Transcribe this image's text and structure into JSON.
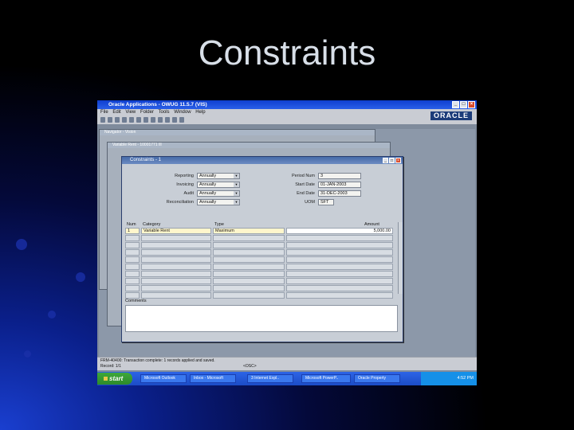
{
  "slide": {
    "title": "Constraints"
  },
  "app": {
    "title": "Oracle Applications - OWUG 11.5.7 (VIS)",
    "logo": "ORACLE",
    "menu": [
      "File",
      "Edit",
      "View",
      "Folder",
      "Tools",
      "Window",
      "Help"
    ]
  },
  "background_windows": [
    {
      "title": "Navigator - Vision"
    },
    {
      "title": "Variable Rent - 10001771 Ill"
    }
  ],
  "constraints_window": {
    "title": "Constraints - 1",
    "left_fields": [
      {
        "label": "Reporting",
        "value": "Annually"
      },
      {
        "label": "Invoicing",
        "value": "Annually"
      },
      {
        "label": "Audit",
        "value": "Annually"
      },
      {
        "label": "Reconciliation",
        "value": "Annually"
      }
    ],
    "right_fields": [
      {
        "label": "Period Num",
        "value": "3"
      },
      {
        "label": "Start Date",
        "value": "01-JAN-2003"
      },
      {
        "label": "End Date",
        "value": "31-DEC-2003"
      },
      {
        "label": "UOM",
        "value": "SFT"
      }
    ],
    "grid": {
      "headers": {
        "num": "Num",
        "category": "Category",
        "type": "Type",
        "amount": "Amount"
      },
      "rows": [
        {
          "num": "1",
          "category": "Variable Rent",
          "type": "Maximum",
          "amount": "5,000.00"
        },
        {
          "num": "",
          "category": "",
          "type": "",
          "amount": ""
        },
        {
          "num": "",
          "category": "",
          "type": "",
          "amount": ""
        },
        {
          "num": "",
          "category": "",
          "type": "",
          "amount": ""
        },
        {
          "num": "",
          "category": "",
          "type": "",
          "amount": ""
        },
        {
          "num": "",
          "category": "",
          "type": "",
          "amount": ""
        },
        {
          "num": "",
          "category": "",
          "type": "",
          "amount": ""
        },
        {
          "num": "",
          "category": "",
          "type": "",
          "amount": ""
        },
        {
          "num": "",
          "category": "",
          "type": "",
          "amount": ""
        },
        {
          "num": "",
          "category": "",
          "type": "",
          "amount": ""
        }
      ]
    },
    "comments_label": "Comments"
  },
  "status": {
    "message": "FRM-40400: Transaction complete: 1 records applied and saved.",
    "record": "Record: 1/1",
    "osc": "<OSC>"
  },
  "taskbar": {
    "start": "start",
    "tasks": [
      "Microsoft Outlook",
      "Inbox - Microsoft",
      "3 Internet Expl..",
      "Microsoft PowerP..",
      "Oracle Property"
    ],
    "clock": "4:52 PM"
  },
  "colors": {
    "title_bar": "#1f4fd8",
    "taskbar": "#245edb",
    "start": "#3a9a35",
    "slide_bg": "#000000"
  }
}
